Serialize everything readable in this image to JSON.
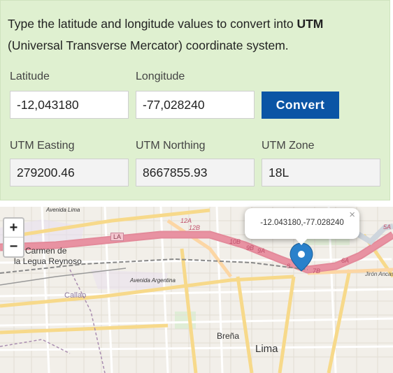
{
  "intro": {
    "prefix": "Type the latitude and longitude values to convert into ",
    "bold": "UTM",
    "suffix": "(Universal Transverse Mercator) coordinate system."
  },
  "inputs": {
    "latitude_label": "Latitude",
    "latitude_value": "-12,043180",
    "longitude_label": "Longitude",
    "longitude_value": "-77,028240",
    "convert_label": "Convert"
  },
  "outputs": {
    "easting_label": "UTM Easting",
    "easting_value": "279200.46",
    "northing_label": "UTM Northing",
    "northing_value": "8667855.93",
    "zone_label": "UTM Zone",
    "zone_value": "18L"
  },
  "map": {
    "zoom_in": "+",
    "zoom_out": "−",
    "popup_text": "-12.043180,-77.028240",
    "popup_close": "×",
    "marker_color": "#2a81cb",
    "labels": {
      "avenida_lima": "Avenida Lima",
      "carmen_1": "Carmen de",
      "carmen_2": "la Legua Reynoso",
      "callao": "Callao",
      "avenida_argentina": "Avenida Argentina",
      "brena": "Breña",
      "lima": "Lima",
      "road_la": "LA",
      "road_12a": "12A",
      "road_12b": "12B",
      "road_10b": "10B",
      "road_9b": "9B",
      "road_9a": "9A",
      "road_8": "8",
      "road_7b": "7B",
      "road_6a": "6A",
      "road_5a": "5A",
      "jiron_ancash": "Jirón Ancash"
    }
  }
}
